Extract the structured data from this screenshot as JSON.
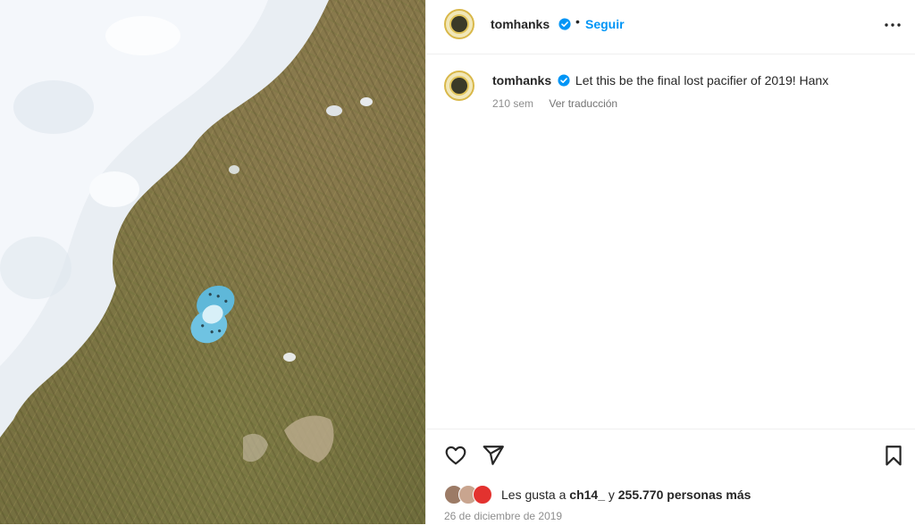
{
  "header": {
    "username": "tomhanks",
    "separator": "•",
    "follow_label": "Seguir",
    "more_icon": "more-options-icon"
  },
  "caption": {
    "username": "tomhanks",
    "text": "Let this be the final lost pacifier of 2019! Hanx",
    "age": "210 sem",
    "translate_label": "Ver traducción"
  },
  "actions": {
    "like_icon": "heart-icon",
    "share_icon": "paper-plane-icon",
    "save_icon": "bookmark-icon"
  },
  "likes": {
    "prefix": "Les gusta a",
    "user": "ch14_",
    "middle": "y",
    "count": "255.770 personas más"
  },
  "date": "26 de diciembre de 2019",
  "colors": {
    "accent": "#0095f6",
    "verified": "#0095f6",
    "pacifier": "#6fc3e2"
  }
}
